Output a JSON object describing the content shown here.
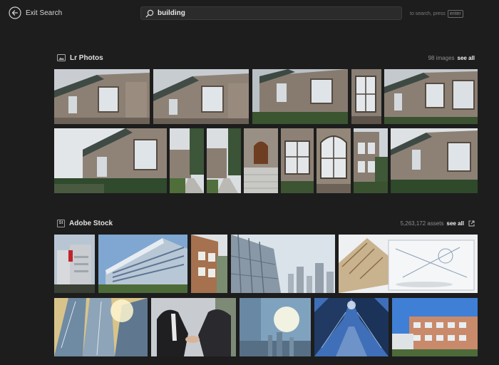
{
  "topbar": {
    "exit_label": "Exit Search",
    "search_value": "building",
    "hint_text": "to search, press",
    "hint_key": "enter"
  },
  "lr_section": {
    "title": "Lr Photos",
    "count": "98 images",
    "see_all": "see all",
    "icon": "photos-icon"
  },
  "stock_section": {
    "title": "Adobe Stock",
    "badge": "St",
    "count": "5,263,172 assets",
    "see_all": "see all",
    "icon": "external-link-icon"
  }
}
